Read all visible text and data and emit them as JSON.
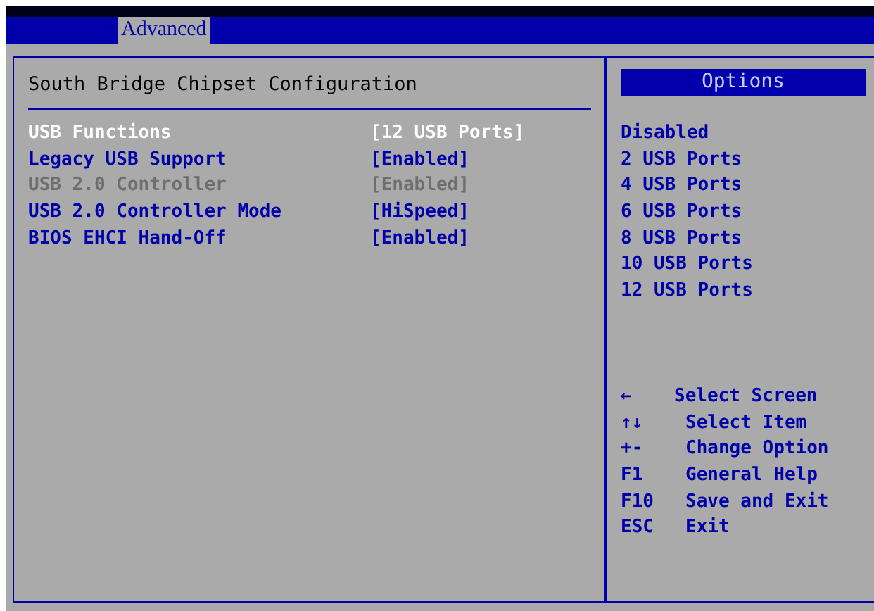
{
  "menu_bar": {
    "tabs": [
      {
        "label": "Advanced",
        "selected": true
      }
    ]
  },
  "settings_panel": {
    "title": "South Bridge Chipset Configuration",
    "items": [
      {
        "label": "USB Functions",
        "value": "[12 USB Ports]",
        "selected": true,
        "disabled": false
      },
      {
        "label": "Legacy USB Support",
        "value": "[Enabled]",
        "selected": false,
        "disabled": false
      },
      {
        "label": "USB 2.0 Controller",
        "value": "[Enabled]",
        "selected": false,
        "disabled": true
      },
      {
        "label": "USB 2.0 Controller Mode",
        "value": "[HiSpeed]",
        "selected": false,
        "disabled": false
      },
      {
        "label": "BIOS EHCI Hand-Off",
        "value": "[Enabled]",
        "selected": false,
        "disabled": false
      }
    ]
  },
  "options_panel": {
    "title": "Options",
    "options": [
      "Disabled",
      "2 USB Ports",
      "4 USB Ports",
      "6 USB Ports",
      "8 USB Ports",
      "10 USB Ports",
      "12 USB Ports"
    ],
    "help": [
      {
        "key": "←",
        "action": "Select Screen"
      },
      {
        "key": "↑↓",
        "action": "Select Item"
      },
      {
        "key": "+-",
        "action": "Change Option"
      },
      {
        "key": "F1",
        "action": "General Help"
      },
      {
        "key": "F10",
        "action": "Save and Exit"
      },
      {
        "key": "ESC",
        "action": "Exit"
      }
    ]
  }
}
